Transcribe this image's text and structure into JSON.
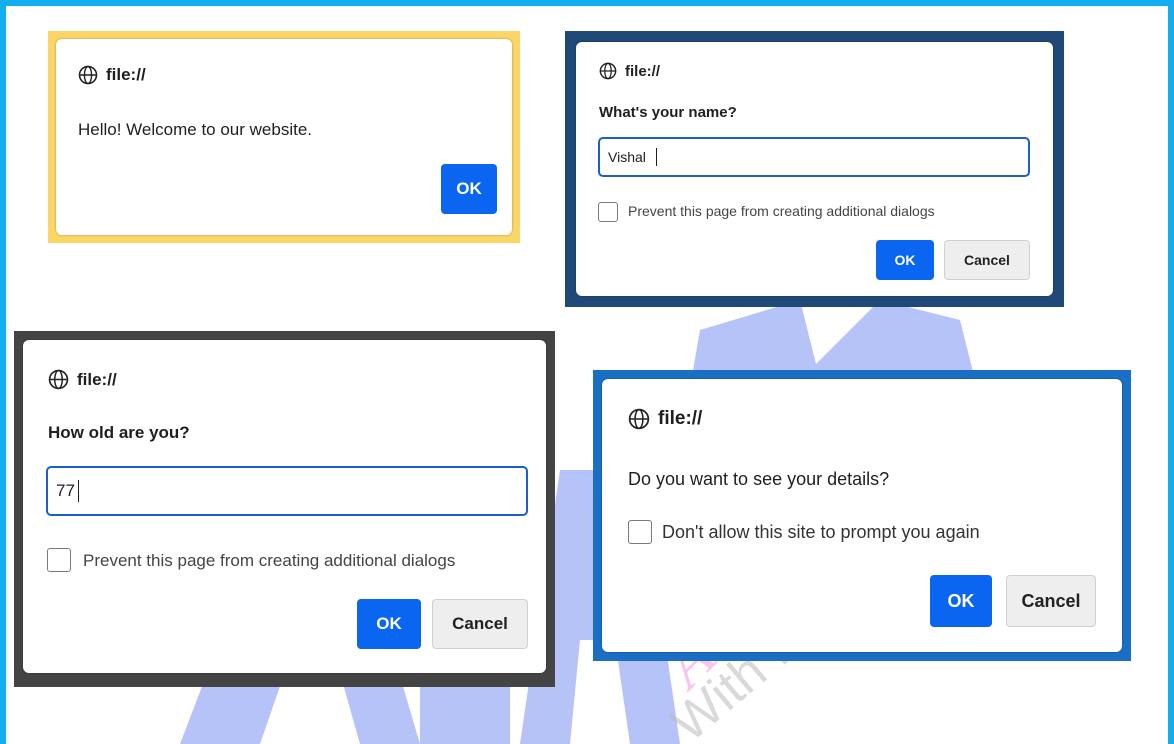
{
  "colors": {
    "page_border": "#12aef0",
    "frame1": "#fbd667",
    "frame2": "#1f4a78",
    "frame3": "#444444",
    "frame4": "#1a6fc4",
    "ok_button": "#0a66f0",
    "input_focus": "#1a5fd0",
    "watermark": "#aebdf7"
  },
  "dialogs": [
    {
      "origin": "file://",
      "origin_icon": "globe-icon",
      "message": "Hello! Welcome to our website.",
      "ok_label": "OK"
    },
    {
      "origin": "file://",
      "origin_icon": "globe-icon",
      "message": "What's your name?",
      "input_value": "Vishal",
      "checkbox_label": "Prevent this page from creating additional dialogs",
      "ok_label": "OK",
      "cancel_label": "Cancel"
    },
    {
      "origin": "file://",
      "origin_icon": "globe-icon",
      "message": "How old are you?",
      "input_value": "77",
      "checkbox_label": "Prevent this page from creating additional dialogs",
      "ok_label": "OK",
      "cancel_label": "Cancel"
    },
    {
      "origin": "file://",
      "origin_icon": "globe-icon",
      "message": "Do you want to see your details?",
      "checkbox_label": "Don't allow this site to prompt you again",
      "ok_label": "OK",
      "cancel_label": "Cancel"
    }
  ],
  "watermark": {
    "brand": "Academy",
    "tagline": "With Innovation......"
  }
}
